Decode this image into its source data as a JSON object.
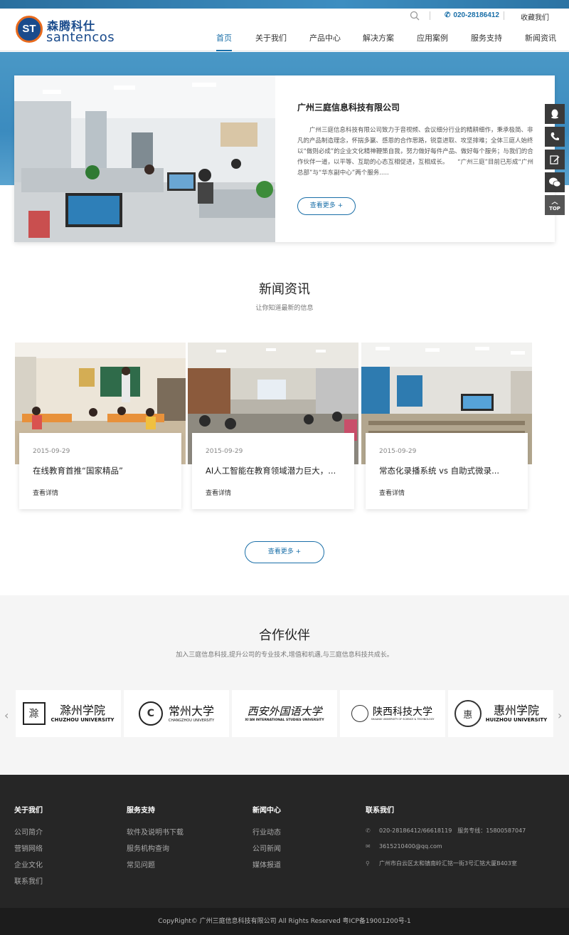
{
  "header": {
    "logo_badge": "ST",
    "logo_cn": "森腾科仕",
    "logo_en": "santencos",
    "phone": "020-28186412",
    "favorite": "收藏我们"
  },
  "nav": {
    "items": [
      "首页",
      "关于我们",
      "产品中心",
      "解决方案",
      "应用案例",
      "服务支持",
      "新闻资讯"
    ],
    "active": 0
  },
  "about": {
    "title": "广州三庭信息科技有限公司",
    "text": "广州三庭信息科技有限公司致力于音视频、会议细分行业的精耕细作，秉承极简、非凡的产品制造理念，怀揣多赢、感恩的合作思路，锐意进取、攻坚排难；全体三庭人始终以“做则必成”的企业文化精神鞭策自我，努力做好每件产品、做好每个服务；与我们的合作伙伴一道，以平等、互助的心态互相促进，互相成长。　　“广州三庭”目前已形成“广州总部”与“华东副中心”两个服务.....",
    "more": "查看更多 +"
  },
  "side": {
    "top_label": "TOP"
  },
  "news": {
    "title": "新闻资讯",
    "subtitle": "让你知道最新的信息",
    "items": [
      {
        "date": "2015-09-29",
        "title": "在线教育首推“国家精品”",
        "link": "查看详情"
      },
      {
        "date": "2015-09-29",
        "title": "AI人工智能在教育领域潜力巨大，...",
        "link": "查看详情"
      },
      {
        "date": "2015-09-29",
        "title": "常态化录播系统 vs 自助式微录...",
        "link": "查看详情"
      }
    ],
    "more": "查看更多 +"
  },
  "partners": {
    "title": "合作伙伴",
    "subtitle": "加入三庭信息科技,提升公司的专业技术,增值和机遇,与三庭信息科技共成长。",
    "logos": [
      {
        "cn": "滁州学院",
        "en": "CHUZHOU UNIVERSITY"
      },
      {
        "cn": "常州大学",
        "en": "CHANGZHOU UNIVERSITY"
      },
      {
        "cn": "西安外国语大学",
        "en": "XI'AN INTERNATIONAL STUDIES UNIVERSITY"
      },
      {
        "cn": "陕西科技大学",
        "en": "SHAANXI UNIVERSITY OF SCIENCE & TECHNOLOGY"
      },
      {
        "cn": "惠州学院",
        "en": "HUIZHOU UNIVERSITY"
      }
    ]
  },
  "footer": {
    "about": {
      "title": "关于我们",
      "links": [
        "公司简介",
        "营销网络",
        "企业文化",
        "联系我们"
      ]
    },
    "service": {
      "title": "服务支持",
      "links": [
        "软件及说明书下载",
        "服务机构查询",
        "常见问题"
      ]
    },
    "news": {
      "title": "新闻中心",
      "links": [
        "行业动态",
        "公司新闻",
        "媒体报道"
      ]
    },
    "contact": {
      "title": "联系我们",
      "phone": "020-28186412/66618119　服务专线：15800587047",
      "email": "3615210400@qq.com",
      "address": "广州市白云区太和镇南岭汇铭一街3号汇铭大厦B403室"
    },
    "copyright": "CopyRight© 广州三庭信息科技有限公司 All Rights Reserved  粤ICP备19001200号-1"
  }
}
